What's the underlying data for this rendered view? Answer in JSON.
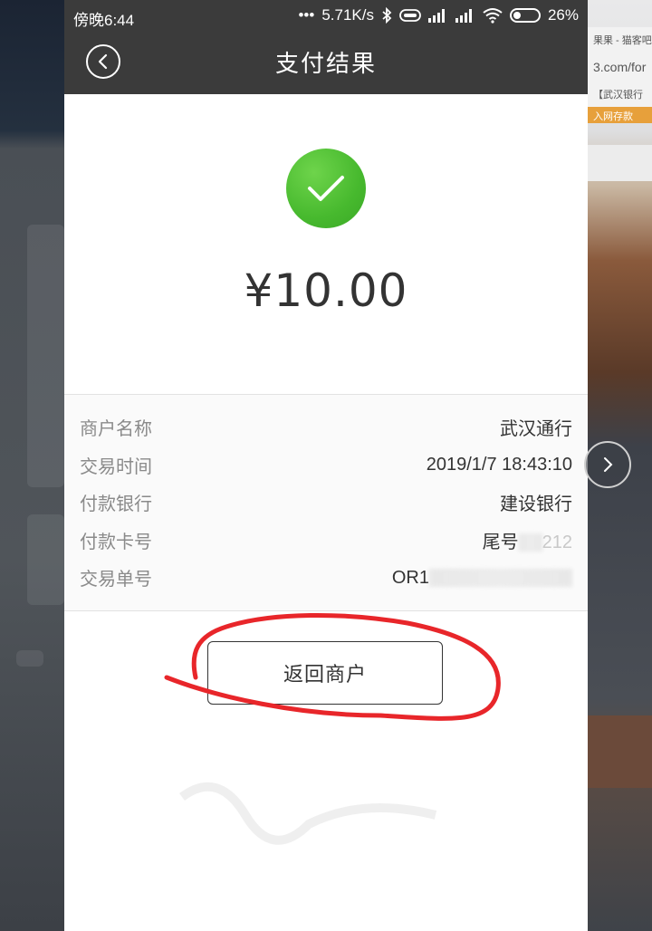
{
  "status_bar": {
    "time": "傍晚6:44",
    "dots": "•••",
    "net_speed": "5.71K/s",
    "battery": "26%"
  },
  "nav": {
    "title": "支付结果"
  },
  "payment": {
    "amount": "¥10.00"
  },
  "details": [
    {
      "label": "商户名称",
      "value": "武汉通行"
    },
    {
      "label": "交易时间",
      "value": "2019/1/7 18:43:10"
    },
    {
      "label": "付款银行",
      "value": "建设银行"
    },
    {
      "label": "付款卡号",
      "value": "尾号",
      "value_tail": "212"
    },
    {
      "label": "交易单号",
      "value": "OR1"
    }
  ],
  "actions": {
    "return_label": "返回商户"
  },
  "background": {
    "right_texts": [
      "果果 - 猫客吧",
      "3.com/for",
      "【武汉银行",
      "入网存款"
    ]
  },
  "colors": {
    "header_bg": "#3b3b3b",
    "success_green": "#47b92e",
    "annotation_red": "#e8262a"
  }
}
